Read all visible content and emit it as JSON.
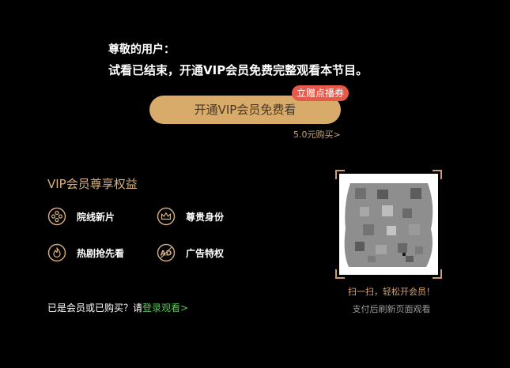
{
  "prompt": {
    "greeting": "尊敬的用户：",
    "message": "试看已结束，开通VIP会员免费完整观看本节目。"
  },
  "cta": {
    "vip_button_label": "开通VIP会员免费看",
    "gift_badge": "立赠点播券",
    "buy_link": "5.0元购买>"
  },
  "benefits": {
    "title": "VIP会员尊享权益",
    "items": [
      {
        "label": "院线新片",
        "icon": "film-reel-icon"
      },
      {
        "label": "尊贵身份",
        "icon": "crown-icon"
      },
      {
        "label": "热剧抢先看",
        "icon": "flame-icon"
      },
      {
        "label": "广告特权",
        "icon": "no-ad-icon"
      }
    ]
  },
  "login": {
    "prefix": "已是会员或已购买？请",
    "link": "登录观看>"
  },
  "qr": {
    "caption": "扫一扫，轻松开会员！",
    "subcaption": "支付后刷新页面观看"
  },
  "colors": {
    "background": "#000000",
    "gold": "#d9ab6a",
    "badge_red": "#e8594a",
    "login_green": "#5ac85a"
  }
}
